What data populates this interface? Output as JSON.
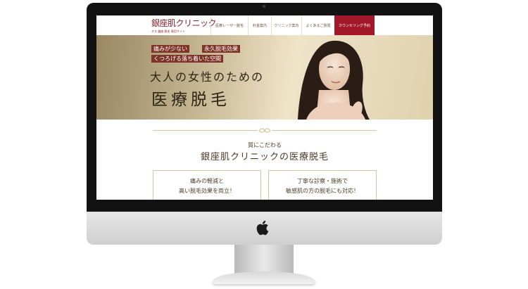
{
  "header": {
    "logo_title": "銀座肌クリニック",
    "logo_sub": "ネス 銀座  脱毛 専用サイト",
    "nav": [
      "医療レーザー脱毛",
      "料金案内",
      "クリニック案内",
      "よくあるご質問",
      "カウンセリング予約"
    ]
  },
  "hero": {
    "tags": [
      "痛みが少ない",
      "永久脱毛効果",
      "くつろげる落ち着いた空間"
    ],
    "line1": "大人の女性のための",
    "line2": "医療脱毛"
  },
  "section": {
    "subtitle": "質にこだわる",
    "title": "銀座肌クリニックの医療脱毛",
    "boxes": [
      {
        "line1": "痛みの軽減と",
        "line2": "高い脱毛効果を両立！"
      },
      {
        "line1": "丁寧な診察・施術で",
        "line2": "敏感肌の方の脱毛にも対応！"
      }
    ]
  },
  "colors": {
    "accent": "#a3172a",
    "gold": "#d8c59e",
    "text": "#4a3a25",
    "tag": "#7d3326"
  }
}
